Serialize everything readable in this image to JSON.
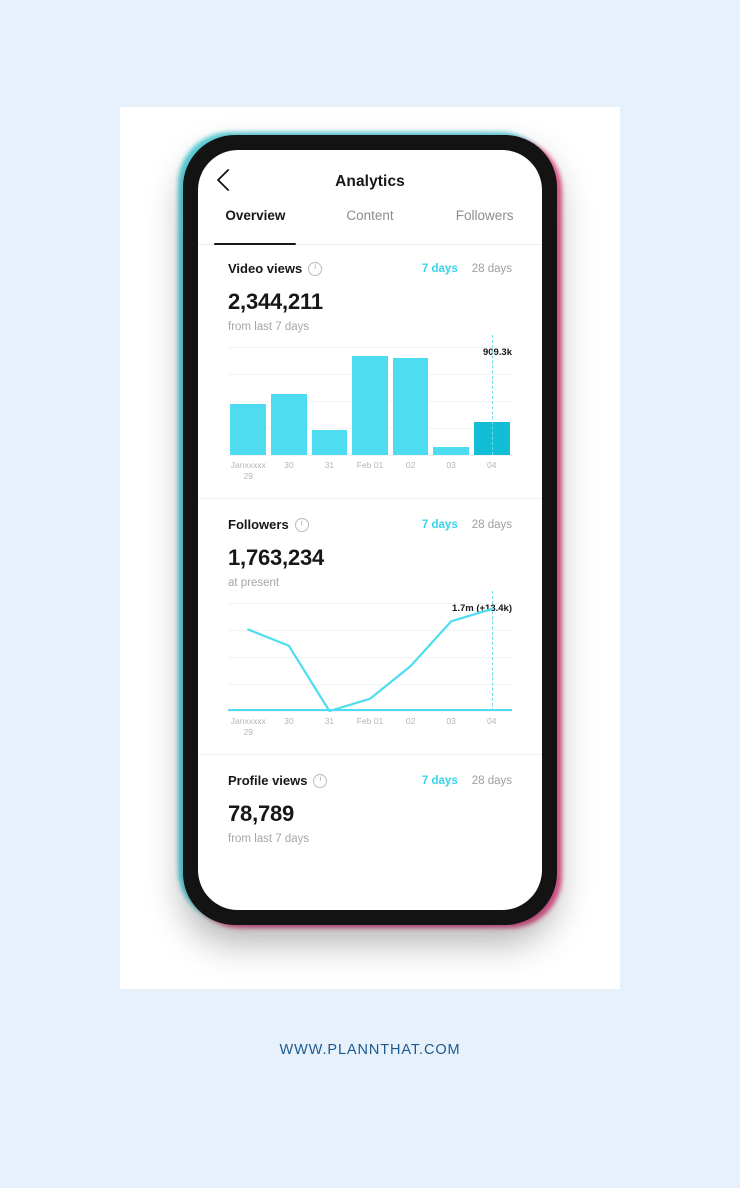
{
  "page": {
    "background_color": "#e7f1fc",
    "footer_url": "WWW.PLANNTHAT.COM",
    "footer_color": "#1d5a8e"
  },
  "app": {
    "title": "Analytics",
    "back_icon": "chevron-left-icon",
    "tabs": [
      {
        "label": "Overview",
        "active": true
      },
      {
        "label": "Content",
        "active": false
      },
      {
        "label": "Followers",
        "active": false
      }
    ],
    "accent_color": "#35d4e8",
    "bar_color": "#4ddcf0",
    "bar_highlight_color": "#12bdd6"
  },
  "sections": [
    {
      "title": "Video views",
      "info_icon": "info-circle-icon",
      "ranges": [
        {
          "label": "7 days",
          "active": true
        },
        {
          "label": "28 days",
          "active": false
        }
      ],
      "value": "2,344,211",
      "sub_label": "from last 7 days",
      "peak_label": "909.3k"
    },
    {
      "title": "Followers",
      "info_icon": "info-circle-icon",
      "ranges": [
        {
          "label": "7 days",
          "active": true
        },
        {
          "label": "28 days",
          "active": false
        }
      ],
      "value": "1,763,234",
      "sub_label": "at present",
      "peak_label": "1.7m (+13.4k)"
    },
    {
      "title": "Profile views",
      "info_icon": "info-circle-icon",
      "ranges": [
        {
          "label": "7 days",
          "active": true
        },
        {
          "label": "28 days",
          "active": false
        }
      ],
      "value": "78,789",
      "sub_label": "from last 7 days"
    }
  ],
  "chart_data": [
    {
      "type": "bar",
      "title": "Video views",
      "categories": [
        "Janxxxxx\n29",
        "30",
        "31",
        "Feb 01",
        "02",
        "03",
        "04"
      ],
      "tick_labels": [
        "Janxxxxx 29",
        "30",
        "31",
        "Feb 01",
        "02",
        "03",
        "04"
      ],
      "values": [
        455,
        545,
        225,
        880,
        860,
        75,
        290
      ],
      "value_unit": "thousand views",
      "ylim": [
        0,
        960
      ],
      "annotation": "909.3k",
      "annotation_index": 6,
      "highlight_index": 6,
      "grid": true,
      "gridline_count": 5,
      "xlabel": "",
      "ylabel": "",
      "legend": "none"
    },
    {
      "type": "line",
      "title": "Followers",
      "categories": [
        "Janxxxxx\n29",
        "30",
        "31",
        "Feb 01",
        "02",
        "03",
        "04"
      ],
      "tick_labels": [
        "Janxxxxx 29",
        "30",
        "31",
        "Feb 01",
        "02",
        "03",
        "04"
      ],
      "values": [
        1690,
        1682,
        1650,
        1656,
        1672,
        1694,
        1700
      ],
      "value_unit": "thousand followers",
      "ylim": [
        1650,
        1703
      ],
      "annotation": "1.7m (+13.4k)",
      "annotation_index": 6,
      "grid": true,
      "gridline_count": 5,
      "baseline": true,
      "xlabel": "",
      "ylabel": "",
      "legend": "none"
    }
  ]
}
